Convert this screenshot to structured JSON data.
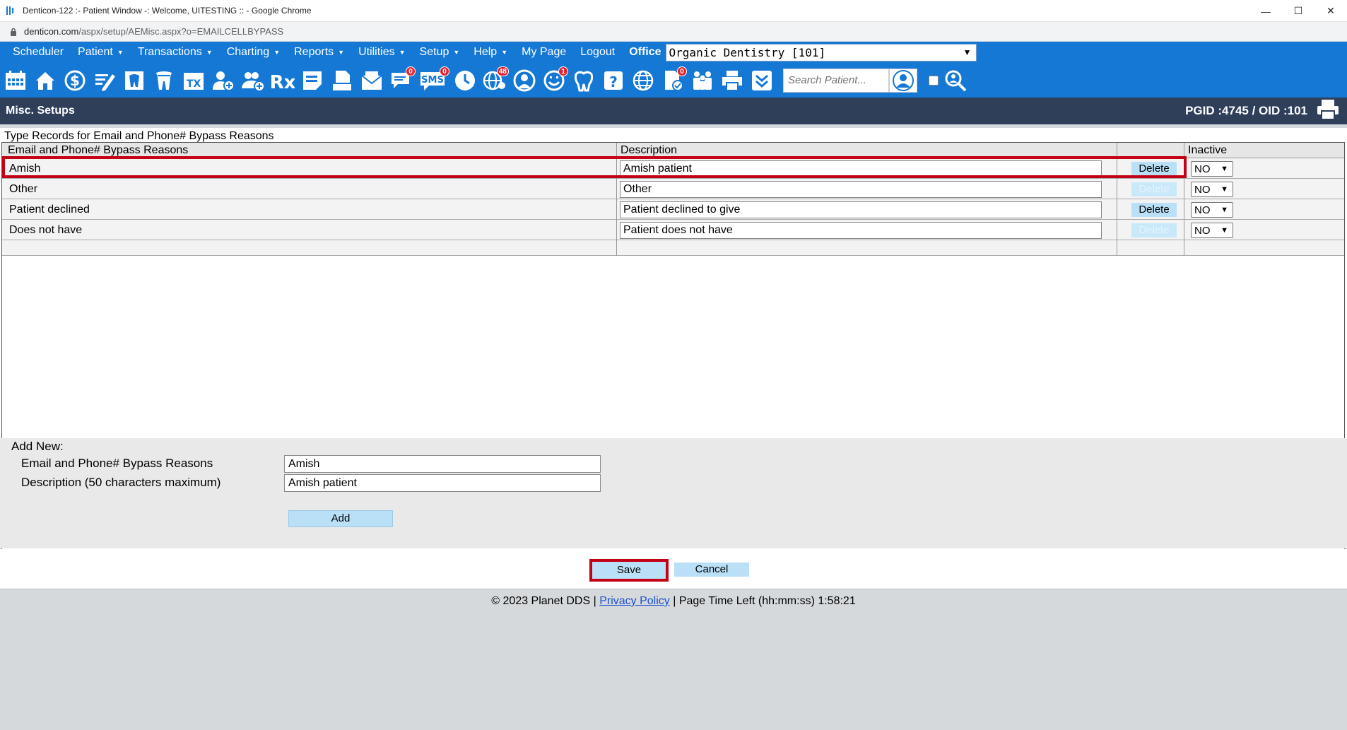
{
  "window": {
    "title": "Denticon-122 :- Patient Window -: Welcome, UITESTING :: - Google Chrome",
    "minimize": "—",
    "maximize": "☐",
    "close": "✕"
  },
  "address": {
    "host": "denticon.com",
    "path": "/aspx/setup/AEMisc.aspx?o=EMAILCELLBYPASS"
  },
  "menu": {
    "items": [
      "Scheduler",
      "Patient",
      "Transactions",
      "Charting",
      "Reports",
      "Utilities",
      "Setup",
      "Help",
      "My Page",
      "Logout"
    ],
    "office_label": "Office",
    "office_value": "Organic Dentistry [101]"
  },
  "toolbar": {
    "icons": [
      "calendar-icon",
      "home-icon",
      "dollar-icon",
      "edit-notes-icon",
      "tooth-chart-icon",
      "tooth-icon",
      "tx-icon",
      "add-patient-icon",
      "add-family-icon",
      "rx-icon",
      "notes-icon",
      "document-icon",
      "mail-icon",
      "messages-icon",
      "sms-icon",
      "clock-icon",
      "globe-users-icon",
      "support-icon",
      "smile-icon",
      "tooth-outline-icon",
      "tooth-question-icon",
      "web-icon",
      "document-check-icon",
      "family-icon",
      "printer-icon",
      "chevron-down-box-icon"
    ],
    "badges": {
      "messages": "0",
      "sms": "0",
      "globe": "48",
      "smile": "1",
      "doc_check": "0"
    },
    "sms_label": "SMS",
    "tx_label": "TX",
    "rx_label": "Rx",
    "search_placeholder": "Search Patient..."
  },
  "section": {
    "title": "Misc. Setups",
    "ids": "PGID :4745  /  OID :101"
  },
  "table": {
    "caption": "Type Records for Email and Phone# Bypass Reasons",
    "headers": {
      "reason": "Email and Phone# Bypass Reasons",
      "description": "Description",
      "inactive": "Inactive"
    },
    "rows": [
      {
        "reason": "Amish",
        "description": "Amish patient",
        "delete": "Delete",
        "inactive": "NO"
      },
      {
        "reason": "Other",
        "description": "Other",
        "delete": "Delete",
        "inactive": "NO"
      },
      {
        "reason": "Patient declined",
        "description": "Patient declined to give",
        "delete": "Delete",
        "inactive": "NO"
      },
      {
        "reason": "Does not have",
        "description": "Patient does not have",
        "delete": "Delete",
        "inactive": "NO"
      }
    ]
  },
  "add_new": {
    "title": "Add New:",
    "reason_label": "Email and Phone# Bypass Reasons",
    "reason_value": "Amish",
    "desc_label": "Description (50 characters maximum)",
    "desc_value": "Amish patient",
    "add_button": "Add"
  },
  "actions": {
    "save": "Save",
    "cancel": "Cancel"
  },
  "footer": {
    "copyright": "© 2023 Planet DDS | ",
    "privacy": "Privacy Policy",
    "time_left": " |  Page Time Left (hh:mm:ss) 1:58:21"
  }
}
